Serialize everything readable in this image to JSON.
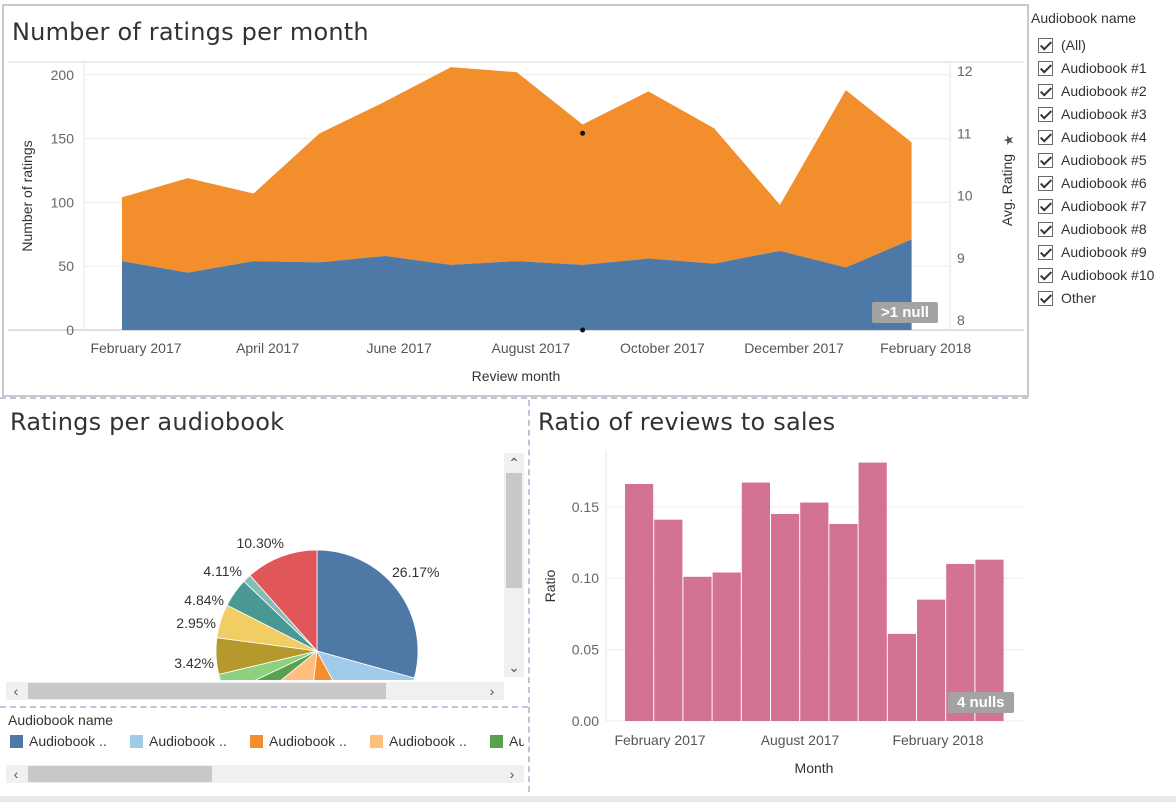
{
  "top": {
    "title": "Number of ratings per month",
    "null_badge": ">1 null"
  },
  "filter": {
    "title": "Audiobook name",
    "items": [
      "(All)",
      "Audiobook #1",
      "Audiobook #2",
      "Audiobook #3",
      "Audiobook #4",
      "Audiobook #5",
      "Audiobook #6",
      "Audiobook #7",
      "Audiobook #8",
      "Audiobook #9",
      "Audiobook #10",
      "Other"
    ]
  },
  "pie": {
    "title": "Ratings per audiobook",
    "legend_title": "Audiobook name",
    "legend_items": [
      "Audiobook ..",
      "Audiobook ..",
      "Audiobook ..",
      "Audiobook ..",
      "Au"
    ],
    "legend_colors": [
      "#4e79a7",
      "#a0cbe8",
      "#f28e2b",
      "#ffbe7d",
      "#59a14f"
    ]
  },
  "ratio": {
    "title": "Ratio  of reviews to sales",
    "null_badge": "4 nulls"
  },
  "icons": {
    "pin": "pin-icon",
    "scroll_up": "chevron-up-icon",
    "scroll_down": "chevron-down-icon",
    "scroll_left": "chevron-left-icon",
    "scroll_right": "chevron-right-icon",
    "checkbox": "checkbox-checked-icon"
  },
  "chart_data": [
    {
      "type": "area",
      "title": "Number of ratings per month",
      "xlabel": "Review month",
      "ylabel": "Number of ratings",
      "y2label": "Avg. Rating",
      "x": [
        "2017-02",
        "2017-03",
        "2017-04",
        "2017-05",
        "2017-06",
        "2017-07",
        "2017-08",
        "2017-09",
        "2017-10",
        "2017-11",
        "2017-12",
        "2018-01",
        "2018-02"
      ],
      "x_tick_labels": [
        "February 2017",
        "April 2017",
        "June 2017",
        "August 2017",
        "October 2017",
        "December 2017",
        "February 2018"
      ],
      "series": [
        {
          "values": [
            54,
            45,
            54,
            53,
            58,
            51,
            54,
            51,
            56,
            52,
            62,
            49,
            71
          ],
          "color": "#4e79a7"
        },
        {
          "values": [
            50,
            74,
            53,
            101,
            121,
            155,
            148,
            110,
            131,
            106,
            36,
            139,
            76
          ],
          "color": "#f28e2b"
        }
      ],
      "stacked": true,
      "ylim": [
        0,
        210
      ],
      "yticks": [
        0,
        50,
        100,
        150,
        200
      ],
      "y2lim": [
        8,
        12
      ],
      "y2ticks": [
        8,
        9,
        10,
        11,
        12
      ],
      "avg_rating_points": [
        {
          "x": "2017-09",
          "y": 11
        },
        {
          "x": "2017-09",
          "y": 8
        }
      ],
      "grid": true
    },
    {
      "type": "pie",
      "title": "Ratings per audiobook",
      "slices": [
        {
          "label": "26.17%",
          "value": 26.17,
          "color": "#4e79a7"
        },
        {
          "label": "",
          "value": 11.5,
          "color": "#a0cbe8"
        },
        {
          "label": "",
          "value": 8.6,
          "color": "#f28e2b"
        },
        {
          "label": "",
          "value": 11.0,
          "color": "#ffbe7d"
        },
        {
          "label": "3.42%",
          "value": 3.42,
          "color": "#59a14f"
        },
        {
          "label": "2.95%",
          "value": 2.95,
          "color": "#8cd17d"
        },
        {
          "label": "",
          "value": 5.2,
          "color": "#b6992d"
        },
        {
          "label": "4.84%",
          "value": 4.84,
          "color": "#f1ce63"
        },
        {
          "label": "4.11%",
          "value": 4.11,
          "color": "#499894"
        },
        {
          "label": "",
          "value": 1.2,
          "color": "#86bcb6"
        },
        {
          "label": "10.30%",
          "value": 10.3,
          "color": "#e15759"
        }
      ]
    },
    {
      "type": "bar",
      "title": "Ratio  of reviews to sales",
      "xlabel": "Month",
      "ylabel": "Ratio",
      "x": [
        "2017-01",
        "2017-02",
        "2017-03",
        "2017-04",
        "2017-05",
        "2017-06",
        "2017-07",
        "2017-08",
        "2017-09",
        "2017-10",
        "2017-11",
        "2017-12",
        "2018-01"
      ],
      "x_tick_labels": [
        "February 2017",
        "August 2017",
        "February 2018"
      ],
      "values": [
        0.166,
        0.141,
        0.101,
        0.104,
        0.167,
        0.145,
        0.153,
        0.138,
        0.181,
        0.061,
        0.085,
        0.11,
        0.113
      ],
      "color": "#d37295",
      "ylim": [
        0,
        0.18
      ],
      "yticks": [
        "0.00",
        "0.05",
        "0.10",
        "0.15"
      ],
      "grid": true
    }
  ]
}
